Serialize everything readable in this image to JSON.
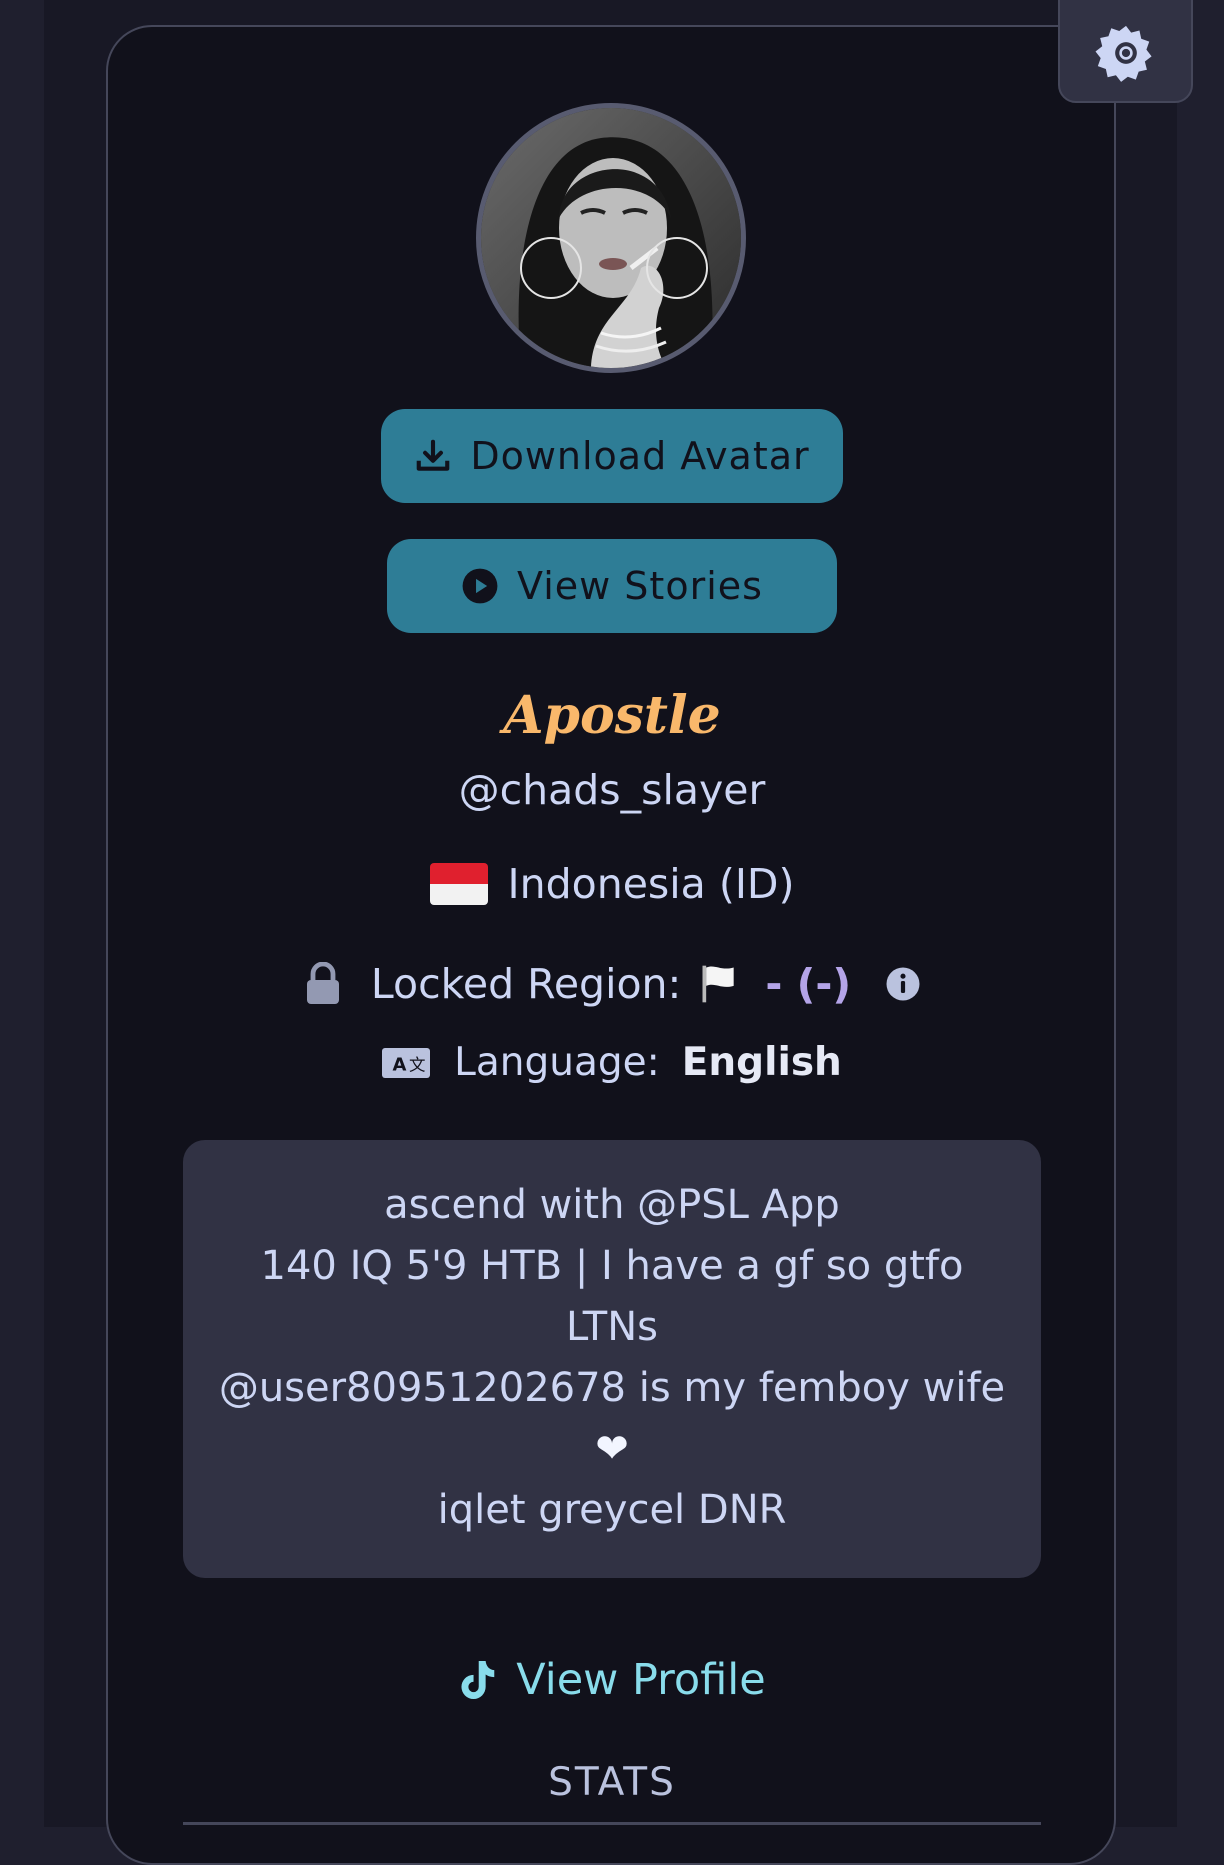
{
  "profile": {
    "display_name": "Apostle",
    "username": "@chads_slayer",
    "country": "Indonesia (ID)",
    "locked_region_label": "Locked Region:",
    "locked_region_value": "- (-)",
    "language_label": "Language:",
    "language_value": "English"
  },
  "buttons": {
    "download_avatar": "Download Avatar",
    "view_stories": "View Stories",
    "view_profile": "View Profile"
  },
  "bio": {
    "lines": [
      "ascend with @PSL App",
      "140 IQ  5'9 HTB | I have a gf so gtfo",
      "LTNs",
      "@user80951202678 is my femboy wife",
      "❤",
      "iqlet greycel DNR"
    ]
  },
  "sections": {
    "stats_heading": "STATS"
  },
  "icons": {
    "settings": "gear-icon",
    "download": "download-icon",
    "play": "play-circle-icon",
    "lock": "lock-icon",
    "info": "info-icon",
    "language": "translate-icon",
    "tiktok": "tiktok-icon"
  },
  "colors": {
    "accent_button": "#2e7d96",
    "display_name": "#f9b86b",
    "link": "#89dceb",
    "region_value": "#b4a4e8"
  }
}
